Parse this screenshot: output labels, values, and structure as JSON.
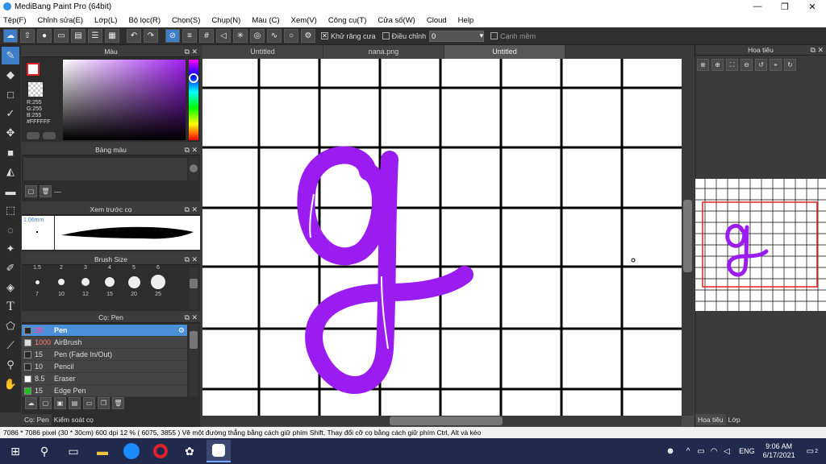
{
  "window": {
    "title": "MediBang Paint Pro (64bit)",
    "minimize": "—",
    "restore": "❐",
    "close": "✕"
  },
  "menu": [
    "Tệp(F)",
    "Chỉnh sửa(E)",
    "Lớp(L)",
    "Bộ lọc(R)",
    "Chọn(S)",
    "Chụp(N)",
    "Màu (C)",
    "Xem(V)",
    "Công cụ(T)",
    "Cửa số(W)",
    "Cloud",
    "Help"
  ],
  "toolbar": {
    "antialias_label": "Khử răng cưa",
    "adjust_label": "Điều chỉnh",
    "adjust_value": "0",
    "edge_label": "Cạnh mềm"
  },
  "color_panel": {
    "title": "Màu",
    "r": "R:255",
    "g": "G:255",
    "b": "B:255",
    "hex": "#FFFFFF"
  },
  "palette_panel": {
    "title": "Bảng màu",
    "footer": "---"
  },
  "preview_panel": {
    "title": "Xem trước cọ",
    "size": "1.06mm"
  },
  "brushsize_panel": {
    "title": "Brush Size",
    "sizes_top": [
      "1.5",
      "2",
      "3",
      "4",
      "5",
      "6"
    ],
    "sizes": [
      "7",
      "10",
      "12",
      "15",
      "20",
      "25"
    ]
  },
  "brush_panel": {
    "title": "Cọ: Pen",
    "items": [
      {
        "size": "25",
        "name": "Pen",
        "color": "#2a2a2a"
      },
      {
        "size": "1000",
        "name": "AirBrush",
        "color": "#dddddd"
      },
      {
        "size": "15",
        "name": "Pen (Fade In/Out)",
        "color": "#2a2a2a"
      },
      {
        "size": "10",
        "name": "Pencil",
        "color": "#2a2a2a"
      },
      {
        "size": "8.5",
        "name": "Eraser",
        "color": "#ffffff"
      },
      {
        "size": "15",
        "name": "Edge Pen",
        "color": "#20c020"
      }
    ],
    "tab1": "Cọ: Pen",
    "tab2": "Kiểm soát cọ"
  },
  "tabs": [
    "Untitled",
    "nana.png",
    "Untitled"
  ],
  "navigator": {
    "title": "Hoa tiêu",
    "tab1": "Hoa tiêu",
    "tab2": "Lớp"
  },
  "status": {
    "text": "7086 * 7086 pixel   (30 * 30cm)   600 dpi   12 %   ( 6075, 3855 )   Vẽ một đường thẳng bằng cách giữ phím Shift, Thay đổi cỡ cọ bằng cách giữ phím Ctrl, Alt và kéo"
  },
  "taskbar": {
    "lang": "ENG",
    "time": "9:06 AM",
    "date": "6/17/2021",
    "notif": "2"
  },
  "colors": {
    "stroke": "#9a1cf0",
    "accent": "#3d7ec9"
  }
}
